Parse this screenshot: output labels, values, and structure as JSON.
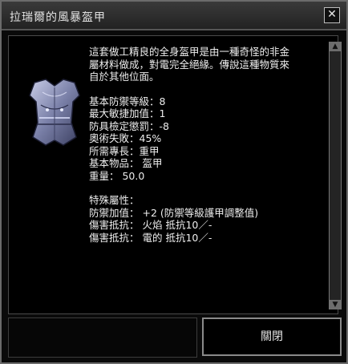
{
  "window": {
    "title": "拉瑞爾的風暴盔甲"
  },
  "description": {
    "intro": [
      "這套做工精良的全身盔甲是由一種奇怪的非金",
      "屬材料做成，對電完全絕緣。傳說這種物質來",
      "自於其他位面。"
    ],
    "stats": [
      "基本防禦等級：8",
      "最大敏捷加值：1",
      "防具檢定懲罰：-8",
      "奧術失敗：45%",
      "所需專長：重甲",
      "基本物品： 盔甲",
      "重量： 50.0"
    ],
    "special": [
      "特殊屬性：",
      "防禦加值： +2 (防禦等級護甲調整值)",
      "傷害抵抗： 火焰 抵抗10／-",
      "傷害抵抗： 電的 抵抗10／-"
    ]
  },
  "buttons": {
    "close_label": "關閉"
  },
  "icons": {
    "item": "plate-armor-icon",
    "close": "close-x-icon",
    "scroll_up": "triangle-up-icon",
    "scroll_down": "triangle-down-icon"
  }
}
